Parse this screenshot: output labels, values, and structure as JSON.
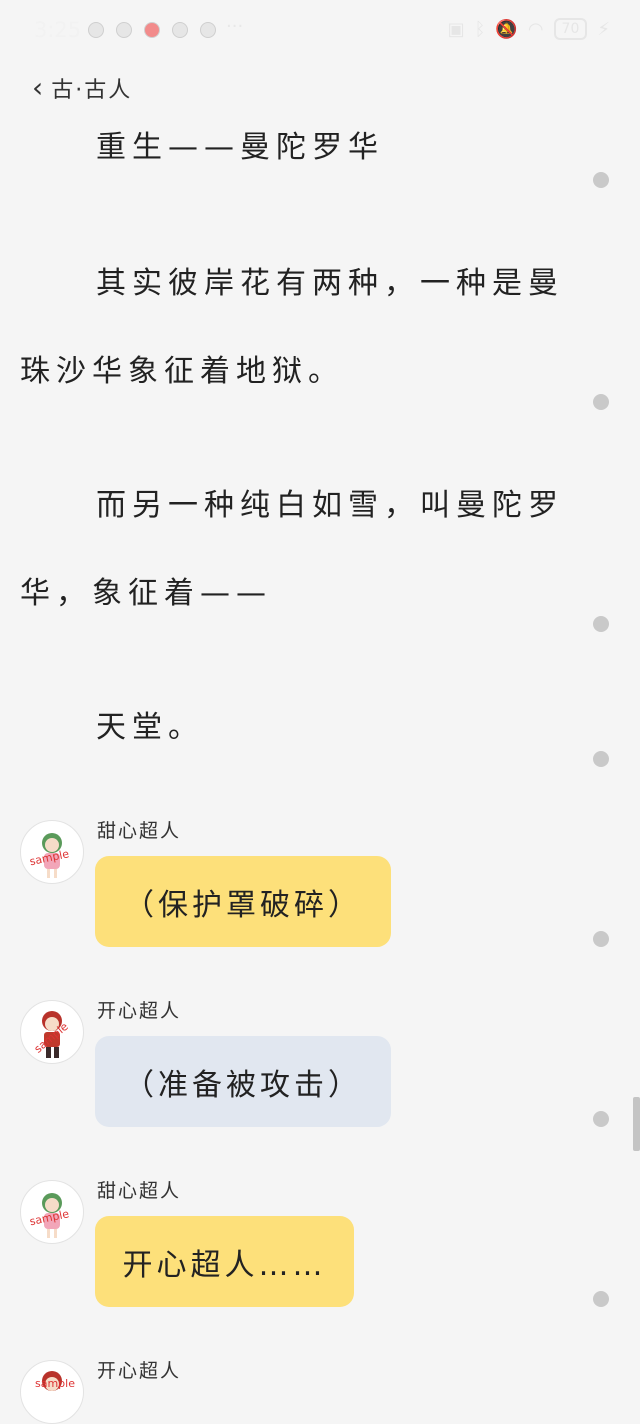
{
  "status": {
    "time": "3:25",
    "more": "···",
    "battery": "70"
  },
  "header": {
    "title": "古·古人"
  },
  "story": {
    "p1": "重生——曼陀罗华",
    "p2_line1": "其实彼岸花有两种，一种是曼",
    "p2_line2": "珠沙华象征着地狱。",
    "p3_line1": "而另一种纯白如雪，叫曼陀罗",
    "p3_line2": "华，象征着——",
    "p4": "天堂。"
  },
  "messages": [
    {
      "sender": "甜心超人",
      "text": "（保护罩破碎）",
      "color": "#fde07a"
    },
    {
      "sender": "开心超人",
      "text": "（准备被攻击）",
      "color": "#e1e7f0"
    },
    {
      "sender": "甜心超人",
      "text": "开心超人……",
      "color": "#fde07a"
    },
    {
      "sender": "开心超人",
      "text": "",
      "color": "#e1e7f0"
    }
  ],
  "avatar_watermark": "sample"
}
